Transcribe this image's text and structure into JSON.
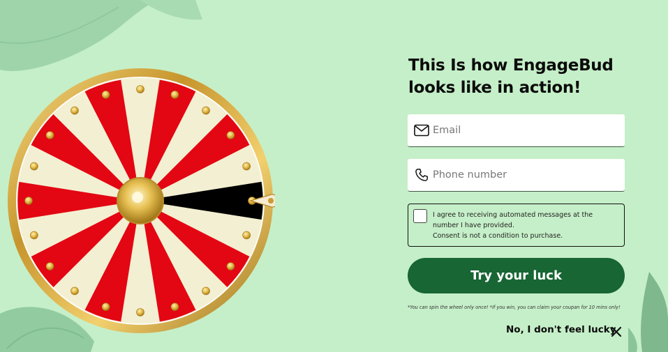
{
  "heading": {
    "line1": "This Is how EngageBud",
    "line2": "looks like in action!"
  },
  "email": {
    "placeholder": "Email",
    "icon": "envelope-icon"
  },
  "phone": {
    "placeholder": "Phone number",
    "icon": "phone-icon"
  },
  "consent": {
    "text1": "I agree to receiving automated messages at the number I have provided.",
    "text2": "Consent is not a condition to purchase."
  },
  "cta": {
    "label": "Try your luck"
  },
  "disclaimer": "*You can spin the wheel only once! *If you win, you can claim your coupan for 10 mins only!",
  "decline": {
    "label": "No, I don't feel lucky"
  },
  "colors": {
    "background": "#c5efc8",
    "button": "#176634",
    "wheel_red": "#e30613",
    "wheel_cream": "#f3efd2",
    "wheel_black": "#000000",
    "wheel_gold": "#d4a93a"
  },
  "wheel": {
    "segments": [
      "red",
      "cream",
      "red",
      "cream",
      "red",
      "cream",
      "black",
      "cream",
      "red",
      "cream",
      "red",
      "cream",
      "red",
      "cream",
      "red",
      "cream",
      "red",
      "cream",
      "red",
      "cream"
    ]
  }
}
